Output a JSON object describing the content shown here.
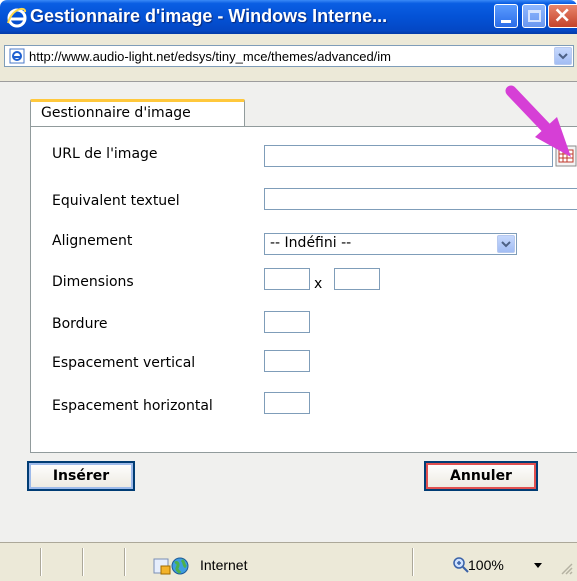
{
  "window": {
    "title": "Gestionnaire d'image - Windows Interne...",
    "icon": "ie-logo-icon",
    "controls": [
      "minimize-icon",
      "maximize-icon",
      "close-icon"
    ]
  },
  "address_bar": {
    "url": "http://www.audio-light.net/edsys/tiny_mce/themes/advanced/im"
  },
  "dialog": {
    "tab_label": "Gestionnaire d'image",
    "fields": {
      "url_label": "URL de l'image",
      "url_value": "",
      "alt_label": "Equivalent textuel",
      "alt_value": "",
      "align_label": "Alignement",
      "align_selected": "-- Indéfini --",
      "dimensions_label": "Dimensions",
      "dimensions_separator": "x",
      "border_label": "Bordure",
      "vspace_label": "Espacement vertical",
      "hspace_label": "Espacement horizontal"
    },
    "buttons": {
      "insert": "Insérer",
      "cancel": "Annuler"
    }
  },
  "status_bar": {
    "zone": "Internet",
    "zoom": "100%"
  },
  "colors": {
    "titlebar": "#0452d6",
    "tab_accent": "#ffc83c",
    "annotation_arrow": "#d63fd6"
  }
}
